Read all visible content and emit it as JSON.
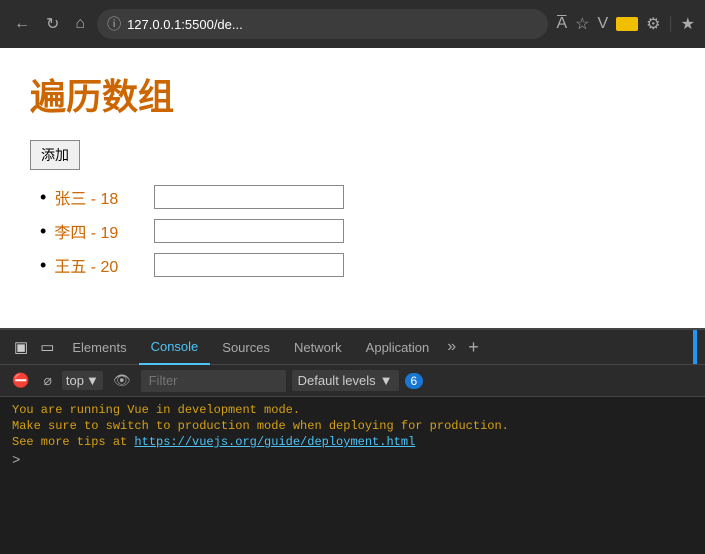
{
  "browser": {
    "url": "127.0.0.1:5500/de...",
    "back_label": "←",
    "refresh_label": "↻",
    "home_label": "⌂"
  },
  "page": {
    "title": "遍历数组",
    "add_button": "添加",
    "list_items": [
      {
        "text": "张三 - 18"
      },
      {
        "text": "李四 - 19"
      },
      {
        "text": "王五 - 20"
      }
    ]
  },
  "devtools": {
    "tabs": [
      "Elements",
      "Console",
      "Sources",
      "Network",
      "Application"
    ],
    "active_tab": "Console",
    "console_filter_placeholder": "Filter",
    "default_levels_label": "Default levels",
    "badge_count": "6",
    "top_label": "top",
    "console_lines": [
      "You are running Vue in development mode.",
      "Make sure to switch to production mode when deploying for production.",
      "See more tips at "
    ],
    "console_link": "https://vuejs.org/guide/deployment.html",
    "prompt": ">"
  }
}
